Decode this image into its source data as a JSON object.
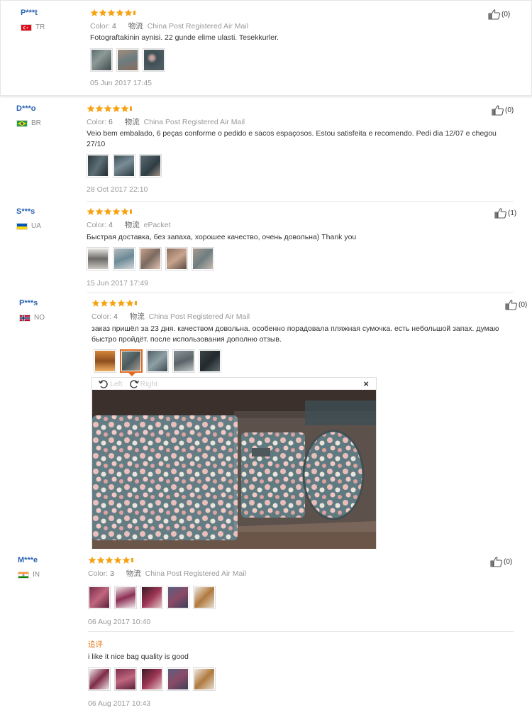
{
  "colors": {
    "star": "#f6a313",
    "username": "#2962b3",
    "accent": "#e26a1e"
  },
  "reviews": [
    {
      "user": "P***t",
      "country": "TR",
      "color_label": "Color:",
      "color_value": "4",
      "ship_cn": "物流",
      "ship": "China Post Registered Air Mail",
      "text": "Fotograftakinin aynisi. 22 gunde elime ulasti. Tesekkurler.",
      "date": "05 Jun 2017 17:45",
      "likes": "(0)"
    },
    {
      "user": "D***o",
      "country": "BR",
      "color_label": "Color:",
      "color_value": "6",
      "ship_cn": "物流",
      "ship": "China Post Registered Air Mail",
      "text": "Veio bem embalado, 6 peças conforme o pedido e sacos espaçosos. Estou satisfeita e recomendo. Pedi dia 12/07 e chegou 27/10",
      "date": "28 Oct 2017 22:10",
      "likes": "(0)"
    },
    {
      "user": "S***s",
      "country": "UA",
      "color_label": "Color:",
      "color_value": "4",
      "ship_cn": "物流",
      "ship": "ePacket",
      "text": "Быстрая доставка, без запаха, хорошее качество, очень довольна) Thank you",
      "date": "15 Jun 2017 17:49",
      "likes": "(1)"
    },
    {
      "user": "P***s",
      "country": "NO",
      "color_label": "Color:",
      "color_value": "4",
      "ship_cn": "物流",
      "ship": "China Post Registered Air Mail",
      "text": "заказ пришёл за 23 дня. качеством довольна. особенно порадовала пляжная сумочка. есть небольшой запах. думаю быстро пройдёт. после использования дополню отзыв.",
      "likes": "(0)",
      "viewer": {
        "left": "Left",
        "right": "Right",
        "close": "×"
      }
    },
    {
      "user": "M***e",
      "country": "IN",
      "color_label": "Color:",
      "color_value": "3",
      "ship_cn": "物流",
      "ship": "China Post Registered Air Mail",
      "date": "06 Aug 2017 10:40",
      "likes": "(0)",
      "followup_label": "追评",
      "followup_text": "i like it nice bag quality is good",
      "followup_date": "06 Aug 2017 10:43"
    }
  ]
}
